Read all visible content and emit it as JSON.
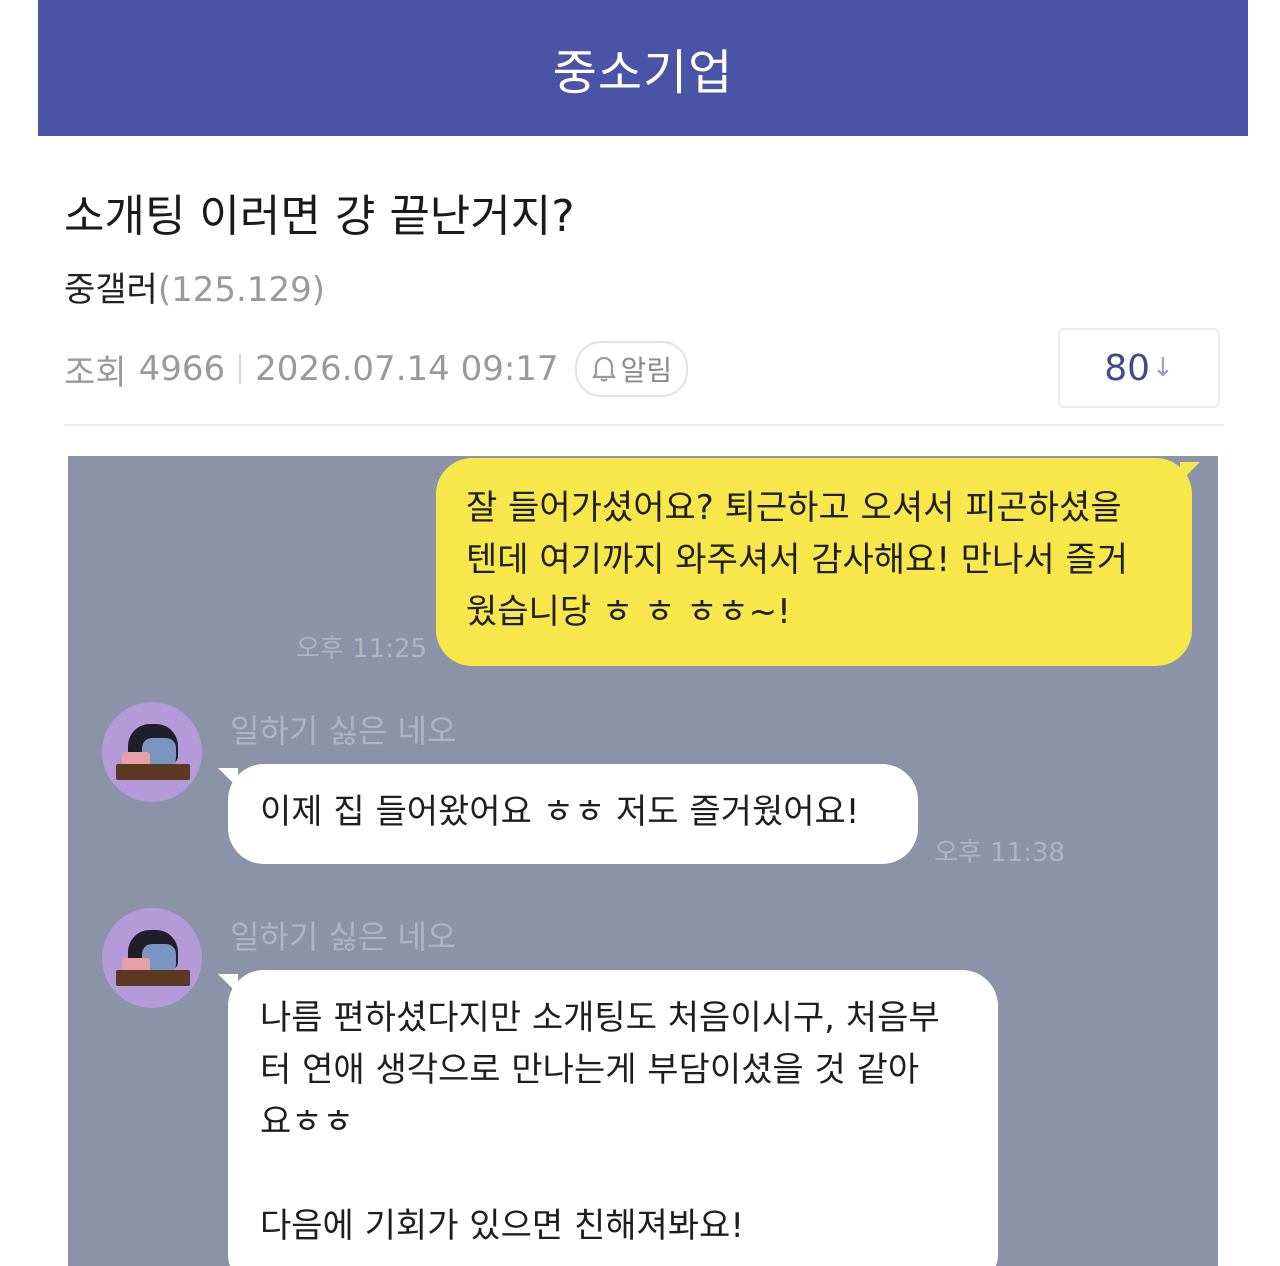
{
  "header": {
    "title": "중소기업"
  },
  "post": {
    "title": "소개팅 이러면 걍 끝난거지?",
    "author": "중갤러",
    "author_ip": "(125.129)",
    "views_label": "조회",
    "views": "4966",
    "datetime": "2026.07.14 09:17",
    "alarm_label": "알림",
    "comment_count": "80",
    "comment_arrow": "↓"
  },
  "chat": {
    "messages": [
      {
        "sender": "me",
        "lines": [
          "잘 들어가셨어요? 퇴근하고 오셔서 피곤하셨을",
          "텐데 여기까지 와주셔서 감사해요! 만나서 즐거",
          "웠습니당 ㅎ ㅎ ㅎㅎ~!"
        ],
        "time": "오후 11:25"
      },
      {
        "sender": "일하기 싫은 네오",
        "lines": [
          "이제 집 들어왔어요 ㅎㅎ 저도 즐거웠어요!"
        ],
        "time": "오후 11:38"
      },
      {
        "sender": "일하기 싫은 네오",
        "lines": [
          "나름 편하셨다지만 소개팅도 처음이시구, 처음부",
          "터 연애 생각으로 만나는게 부담이셨을 것 같아",
          "요ㅎㅎ",
          "",
          "다음에 기회가 있으면 친해져봐요!"
        ]
      }
    ]
  },
  "colors": {
    "header_bg": "#4b53a6",
    "chat_bg": "#8a93a8",
    "my_bubble": "#f7e74a",
    "their_bubble": "#ffffff"
  },
  "icons": {
    "alarm": "bell-icon",
    "avatar": "neo-avatar-icon"
  }
}
